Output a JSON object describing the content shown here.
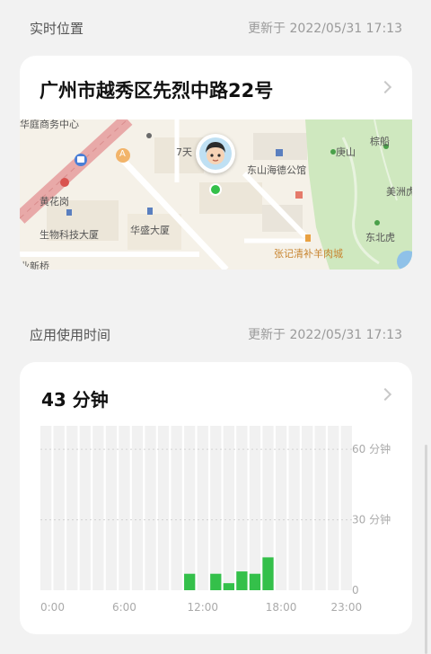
{
  "location": {
    "section_title": "实时位置",
    "updated_text": "更新于 2022/05/31 17:13",
    "address": "广州市越秀区先烈中路22号",
    "map_labels": {
      "poi_top_left": "华庭商务中心",
      "poi_huanghuagang": "黄花岗",
      "poi_biotech": "生物科技大厦",
      "poi_huasheng": "华盛大厦",
      "poi_xinqiao": "业新桥",
      "poi_7days": "7天",
      "poi_dongshan": "东山海德公馆",
      "poi_zhangji": "张记清补羊肉城",
      "poi_gengshan": "庚山",
      "poi_zongchuan": "棕船",
      "poi_meizhou": "美洲虎",
      "poi_dongbeihu": "东北虎",
      "badge_a": "A"
    }
  },
  "usage": {
    "section_title": "应用使用时间",
    "updated_text": "更新于 2022/05/31 17:13",
    "total": "43 分钟"
  },
  "colors": {
    "accent_green": "#34c04a",
    "column_bg": "#f1f1f1",
    "park_green": "#cfe8bf",
    "road_red": "#e8a9a8"
  },
  "chart_data": {
    "type": "bar",
    "title": "",
    "xlabel": "",
    "ylabel": "",
    "ylim": [
      0,
      70
    ],
    "grid": true,
    "y_ticks": [
      {
        "value": 60,
        "label": "60 分钟"
      },
      {
        "value": 30,
        "label": "30 分钟"
      },
      {
        "value": 0,
        "label": "0"
      }
    ],
    "x_tick_labels": [
      {
        "hour": 0,
        "label": "0:00"
      },
      {
        "hour": 6,
        "label": "6:00"
      },
      {
        "hour": 12,
        "label": "12:00"
      },
      {
        "hour": 18,
        "label": "18:00"
      },
      {
        "hour": 23,
        "label": "23:00"
      }
    ],
    "categories": [
      "0",
      "1",
      "2",
      "3",
      "4",
      "5",
      "6",
      "7",
      "8",
      "9",
      "10",
      "11",
      "12",
      "13",
      "14",
      "15",
      "16",
      "17",
      "18",
      "19",
      "20",
      "21",
      "22",
      "23"
    ],
    "values": [
      0,
      0,
      0,
      0,
      0,
      0,
      0,
      0,
      0,
      0,
      0,
      7,
      0,
      7,
      3,
      8,
      7,
      14,
      0,
      0,
      0,
      0,
      0,
      0
    ]
  }
}
